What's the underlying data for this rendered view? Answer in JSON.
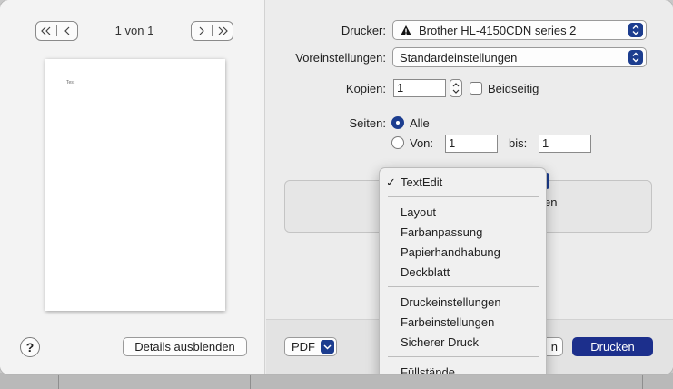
{
  "preview": {
    "nav_first_prev": "≪ | <",
    "page_count": "1 von 1",
    "nav_next_last": "> | ≫",
    "page_text": "Test",
    "help_label": "?",
    "details_button": "Details ausblenden"
  },
  "form": {
    "printer_label": "Drucker:",
    "printer_value": "Brother HL-4150CDN series 2",
    "presets_label": "Voreinstellungen:",
    "presets_value": "Standardeinstellungen",
    "copies_label": "Kopien:",
    "copies_value": "1",
    "duplex_label": "Beidseitig",
    "pages_label": "Seiten:",
    "pages_all": "Alle",
    "pages_from_label": "Von:",
    "pages_from_value": "1",
    "pages_to_label": "bis:",
    "pages_to_value": "1",
    "obscured_text": "en"
  },
  "bottom": {
    "pdf_label": "PDF",
    "partial_label": "n",
    "print_label": "Drucken"
  },
  "menu": {
    "selected_check": "✓",
    "group1": [
      "TextEdit"
    ],
    "group2": [
      "Layout",
      "Farbanpassung",
      "Papierhandhabung",
      "Deckblatt"
    ],
    "group3": [
      "Druckeinstellungen",
      "Farbeinstellungen",
      "Sicherer Druck"
    ],
    "group4": [
      "Füllstände"
    ]
  },
  "colors": {
    "accent": "#1c3d8f",
    "primary_button": "#1c2f8c"
  }
}
